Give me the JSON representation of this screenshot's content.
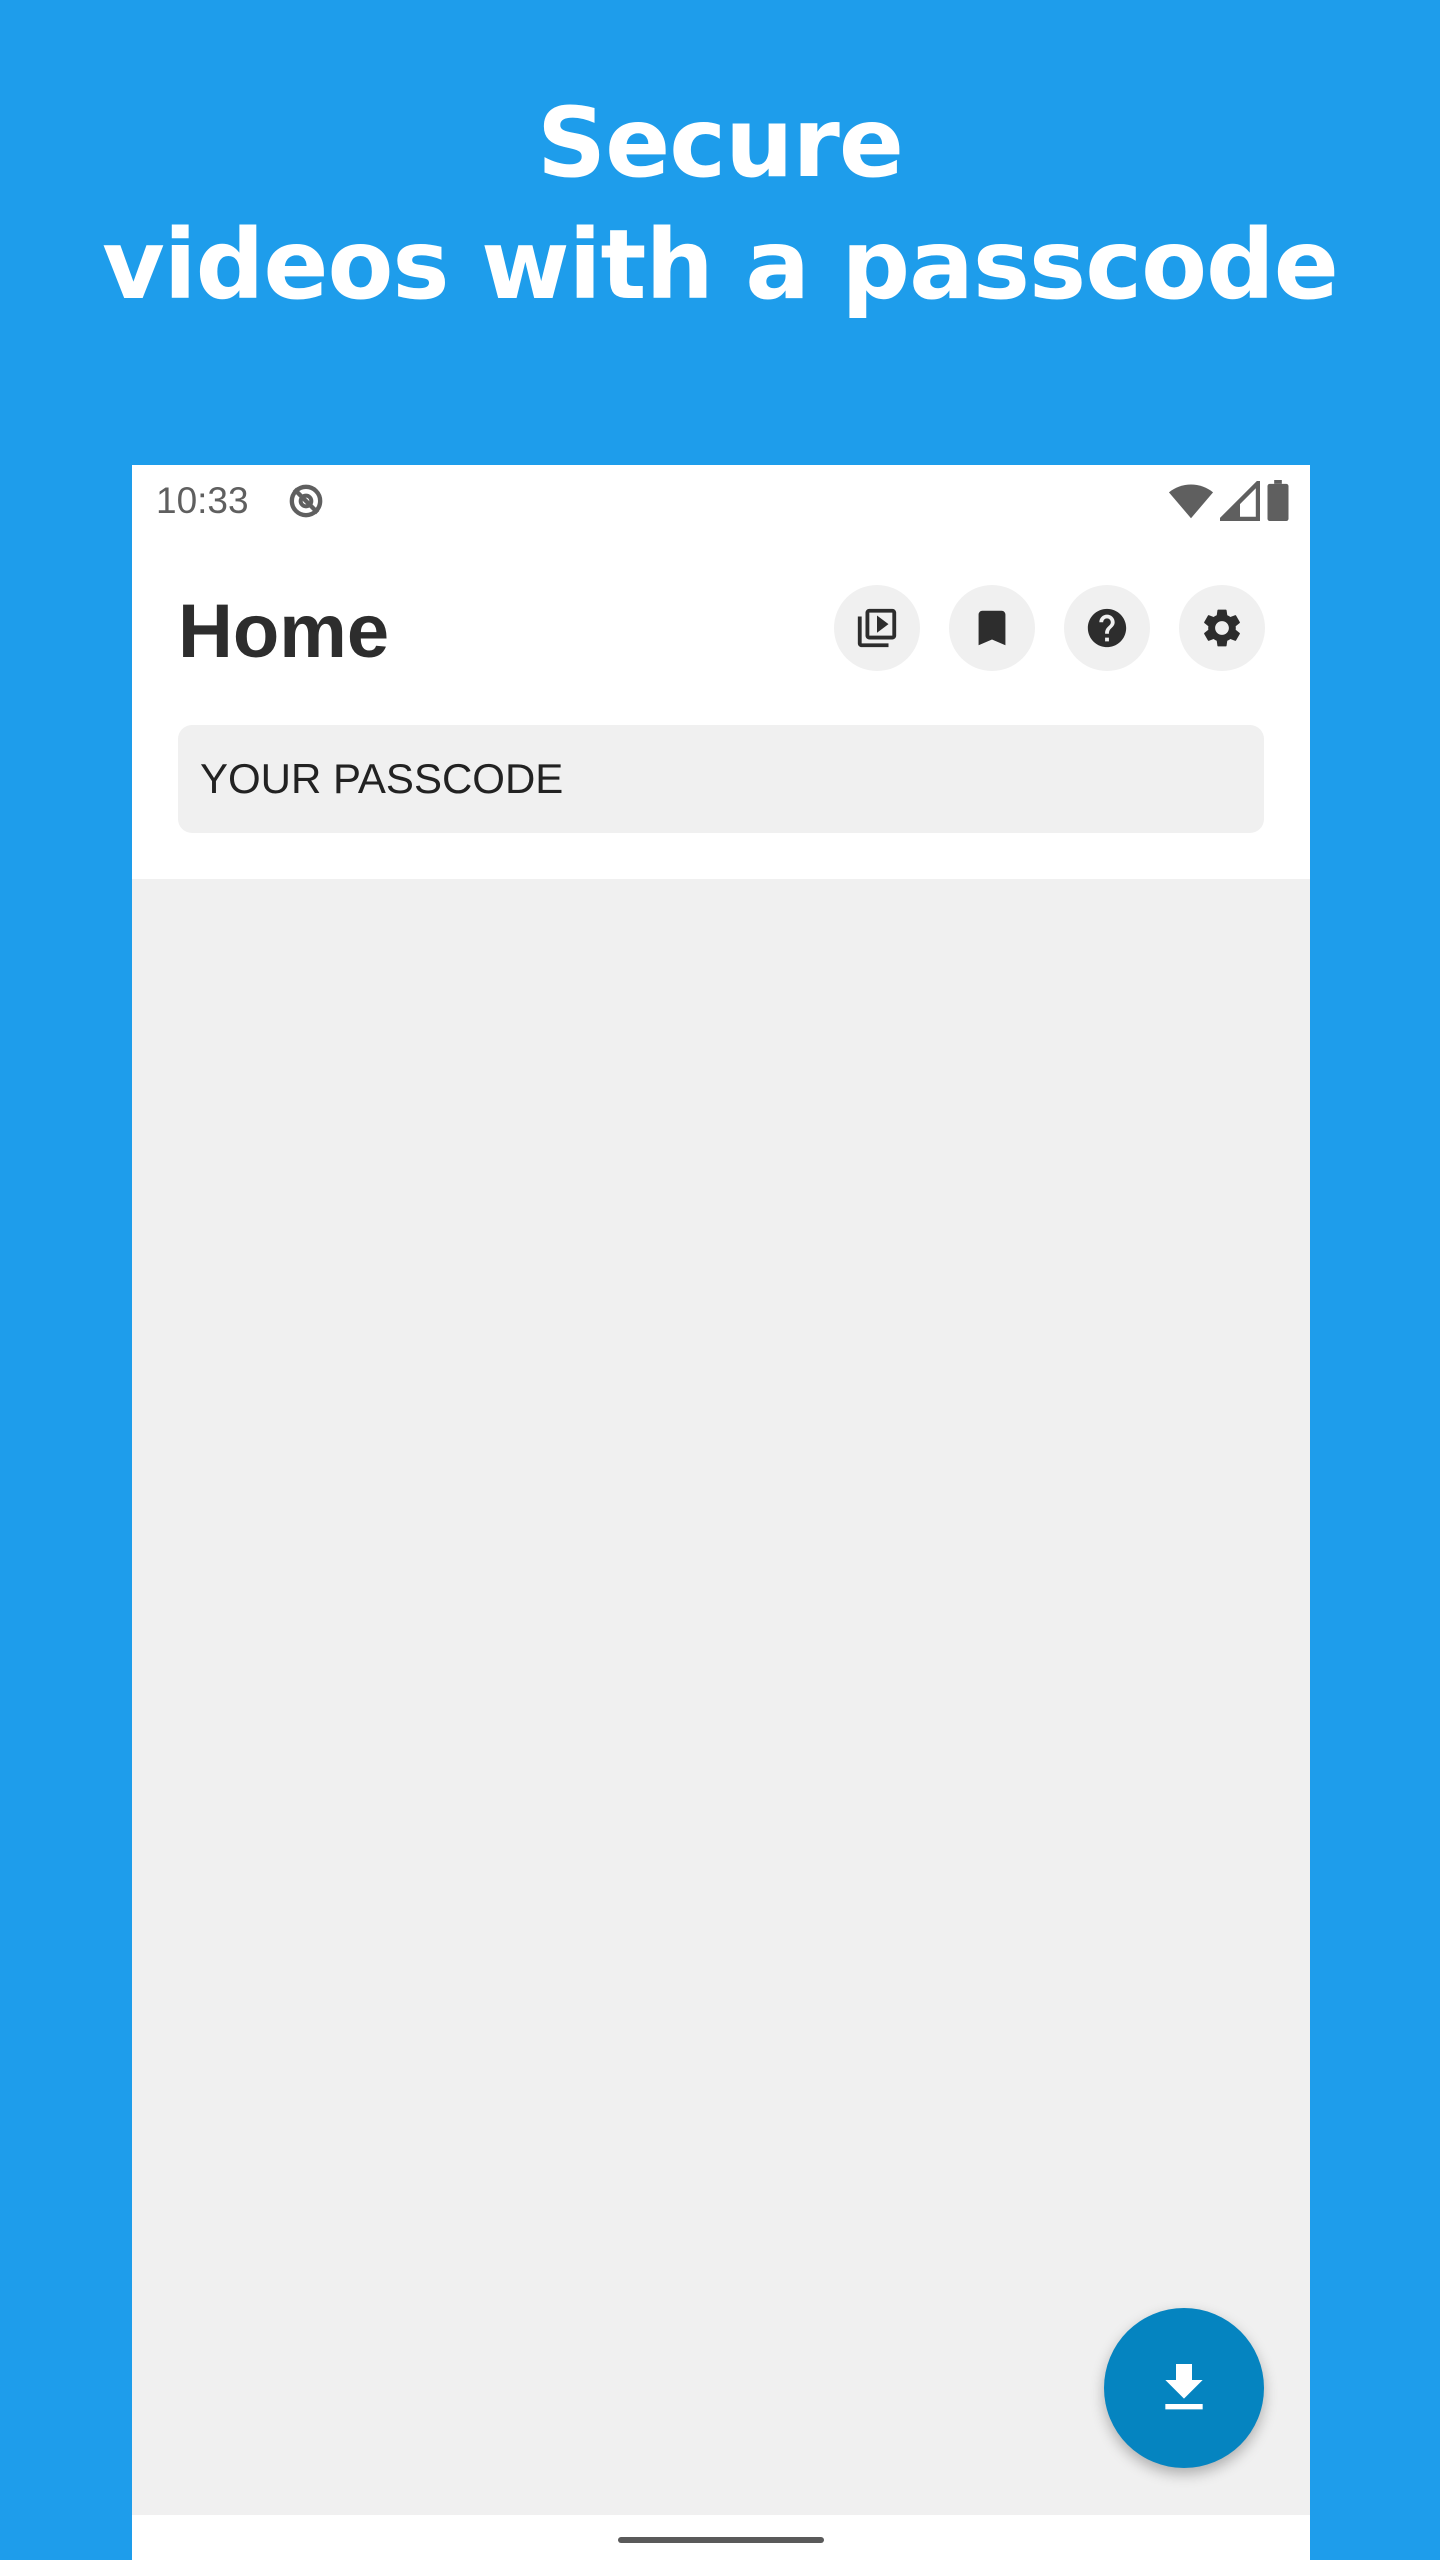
{
  "promo": {
    "headline_line1": "Secure",
    "headline_line2": "videos with a passcode",
    "background_color": "#1e9deb"
  },
  "status_bar": {
    "time": "10:33",
    "left_icon": "data-saver-icon",
    "right_icons": [
      "wifi-icon",
      "cell-signal-icon",
      "battery-icon"
    ]
  },
  "header": {
    "title": "Home",
    "actions": [
      {
        "icon": "video-library-icon",
        "name": "video-library-button"
      },
      {
        "icon": "bookmark-icon",
        "name": "bookmark-button"
      },
      {
        "icon": "help-icon",
        "name": "help-button"
      },
      {
        "icon": "gear-icon",
        "name": "settings-button"
      }
    ]
  },
  "passcode": {
    "placeholder": "YOUR PASSCODE",
    "value": ""
  },
  "fab": {
    "icon": "download-icon",
    "color": "#0584c0"
  }
}
